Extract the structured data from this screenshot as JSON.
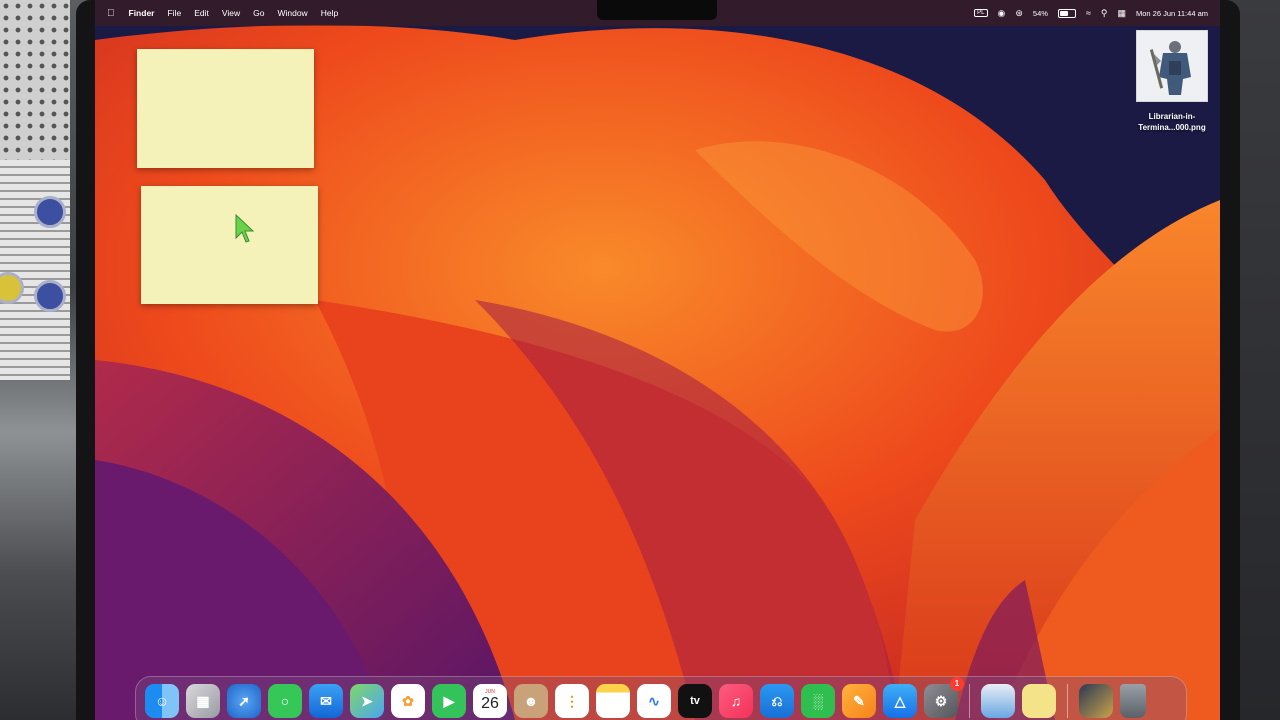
{
  "menubar": {
    "app_name": "Finder",
    "menus": [
      "File",
      "Edit",
      "View",
      "Go",
      "Window",
      "Help"
    ],
    "status": {
      "input_source": "PL",
      "battery": "54%",
      "battery_level": 0.54,
      "datetime": "Mon 26 Jun  11:44 am"
    }
  },
  "desktop": {
    "file": {
      "name_line1": "Librarian-in-",
      "name_line2": "Termina...000.png"
    }
  },
  "dock": {
    "calendar": {
      "month": "JUN",
      "day": "26"
    },
    "tv_label": "tv",
    "settings_badge": "1",
    "apps": [
      {
        "name": "finder-icon"
      },
      {
        "name": "launchpad-icon"
      },
      {
        "name": "safari-icon"
      },
      {
        "name": "messages-icon"
      },
      {
        "name": "mail-icon"
      },
      {
        "name": "maps-icon"
      },
      {
        "name": "photos-icon"
      },
      {
        "name": "facetime-icon"
      },
      {
        "name": "calendar-icon"
      },
      {
        "name": "contacts-icon"
      },
      {
        "name": "reminders-icon"
      },
      {
        "name": "notes-icon"
      },
      {
        "name": "freeform-icon"
      },
      {
        "name": "tv-icon"
      },
      {
        "name": "music-icon"
      },
      {
        "name": "keynote-icon"
      },
      {
        "name": "numbers-icon"
      },
      {
        "name": "pages-icon"
      },
      {
        "name": "app-store-icon"
      },
      {
        "name": "system-settings-icon"
      },
      {
        "name": "preview-icon"
      },
      {
        "name": "stickies-icon"
      },
      {
        "name": "league-app-icon"
      },
      {
        "name": "trash-icon"
      }
    ]
  },
  "colors": {
    "sticky": "#f5f2b9",
    "wallpaper_orange": "#f46b1e",
    "wallpaper_red": "#e63a17",
    "wallpaper_purple": "#7a1a6a",
    "wallpaper_navy": "#1b1a45"
  }
}
